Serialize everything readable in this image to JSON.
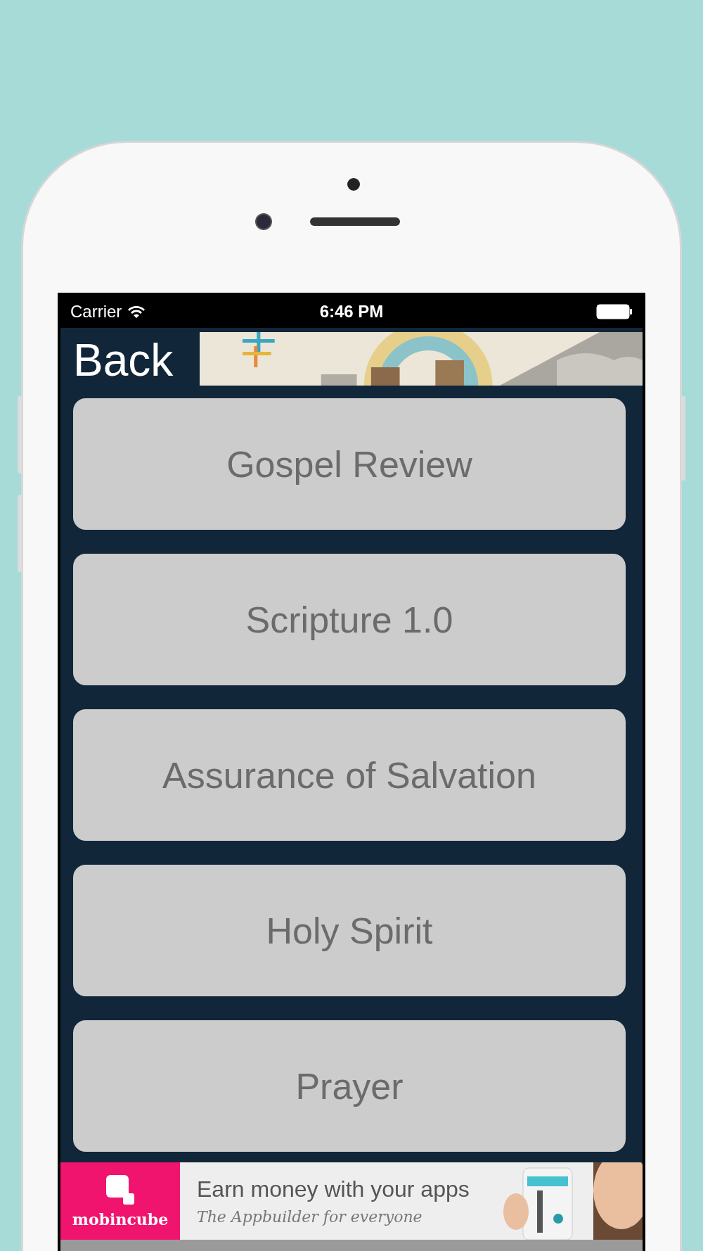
{
  "status_bar": {
    "carrier": "Carrier",
    "time": "6:46 PM"
  },
  "header": {
    "back": "Back"
  },
  "menu": [
    {
      "label": "Gospel Review"
    },
    {
      "label": "Scripture 1.0"
    },
    {
      "label": "Assurance of Salvation"
    },
    {
      "label": "Holy Spirit"
    },
    {
      "label": "Prayer"
    }
  ],
  "ad": {
    "brand": "mobincube",
    "headline": "Earn money with your apps",
    "tagline": "The Appbuilder for everyone"
  }
}
